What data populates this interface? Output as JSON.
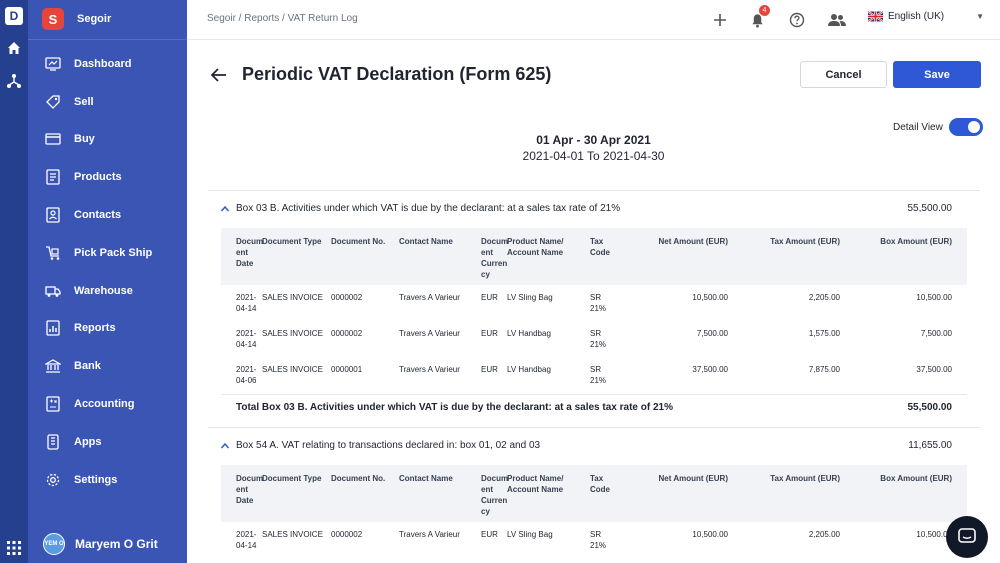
{
  "app": {
    "logo_letter": "D",
    "org_letter": "S",
    "org_name": "Segoir"
  },
  "sidebar": {
    "items": [
      {
        "label": "Dashboard",
        "icon": "dashboard-icon"
      },
      {
        "label": "Sell",
        "icon": "sell-icon"
      },
      {
        "label": "Buy",
        "icon": "buy-icon"
      },
      {
        "label": "Products",
        "icon": "products-icon"
      },
      {
        "label": "Contacts",
        "icon": "contacts-icon"
      },
      {
        "label": "Pick Pack Ship",
        "icon": "pick-pack-ship-icon"
      },
      {
        "label": "Warehouse",
        "icon": "warehouse-icon"
      },
      {
        "label": "Reports",
        "icon": "reports-icon"
      },
      {
        "label": "Bank",
        "icon": "bank-icon"
      },
      {
        "label": "Accounting",
        "icon": "accounting-icon"
      },
      {
        "label": "Apps",
        "icon": "apps-icon"
      },
      {
        "label": "Settings",
        "icon": "settings-icon"
      }
    ],
    "user": {
      "initials": "YEM O",
      "name": "Maryem O Grit"
    }
  },
  "topbar": {
    "breadcrumb": "Segoir / Reports / VAT Return Log",
    "notification_count": "4",
    "language": "English (UK)"
  },
  "page": {
    "title": "Periodic VAT Declaration (Form 625)",
    "cancel_label": "Cancel",
    "save_label": "Save",
    "detail_view_label": "Detail View",
    "detail_view_on": true,
    "period_line1": "01 Apr - 30 Apr 2021",
    "period_line2": "2021-04-01 To 2021-04-30"
  },
  "columns": [
    "Docum ent Date",
    "Document Type",
    "Document No.",
    "Contact Name",
    "Docum ent Curren cy",
    "Product Name/ Account Name",
    "Tax Code",
    "Net Amount (EUR)",
    "Tax Amount (EUR)",
    "Box Amount (EUR)"
  ],
  "sections": [
    {
      "title": "Box 03 B. Activities under which VAT is due by the declarant: at a sales tax rate of 21%",
      "amount": "55,500.00",
      "rows": [
        {
          "date": "2021-04-14",
          "type": "SALES INVOICE",
          "no": "0000002",
          "contact": "Travers A Varieur",
          "currency": "EUR",
          "product": "LV Sling Bag",
          "tax_code": "SR 21%",
          "net": "10,500.00",
          "tax": "2,205.00",
          "box": "10,500.00"
        },
        {
          "date": "2021-04-14",
          "type": "SALES INVOICE",
          "no": "0000002",
          "contact": "Travers A Varieur",
          "currency": "EUR",
          "product": "LV Handbag",
          "tax_code": "SR 21%",
          "net": "7,500.00",
          "tax": "1,575.00",
          "box": "7,500.00"
        },
        {
          "date": "2021-04-06",
          "type": "SALES INVOICE",
          "no": "0000001",
          "contact": "Travers A Varieur",
          "currency": "EUR",
          "product": "LV Handbag",
          "tax_code": "SR 21%",
          "net": "37,500.00",
          "tax": "7,875.00",
          "box": "37,500.00"
        }
      ],
      "total_label": "Total Box 03 B. Activities under which VAT is due by the declarant: at a sales tax rate of 21%",
      "total_amount": "55,500.00"
    },
    {
      "title": "Box 54 A. VAT relating to transactions declared in: box 01, 02 and 03",
      "amount": "11,655.00",
      "rows": [
        {
          "date": "2021-04-14",
          "type": "SALES INVOICE",
          "no": "0000002",
          "contact": "Travers A Varieur",
          "currency": "EUR",
          "product": "LV Sling Bag",
          "tax_code": "SR 21%",
          "net": "10,500.00",
          "tax": "2,205.00",
          "box": "10,500.00"
        }
      ]
    }
  ]
}
